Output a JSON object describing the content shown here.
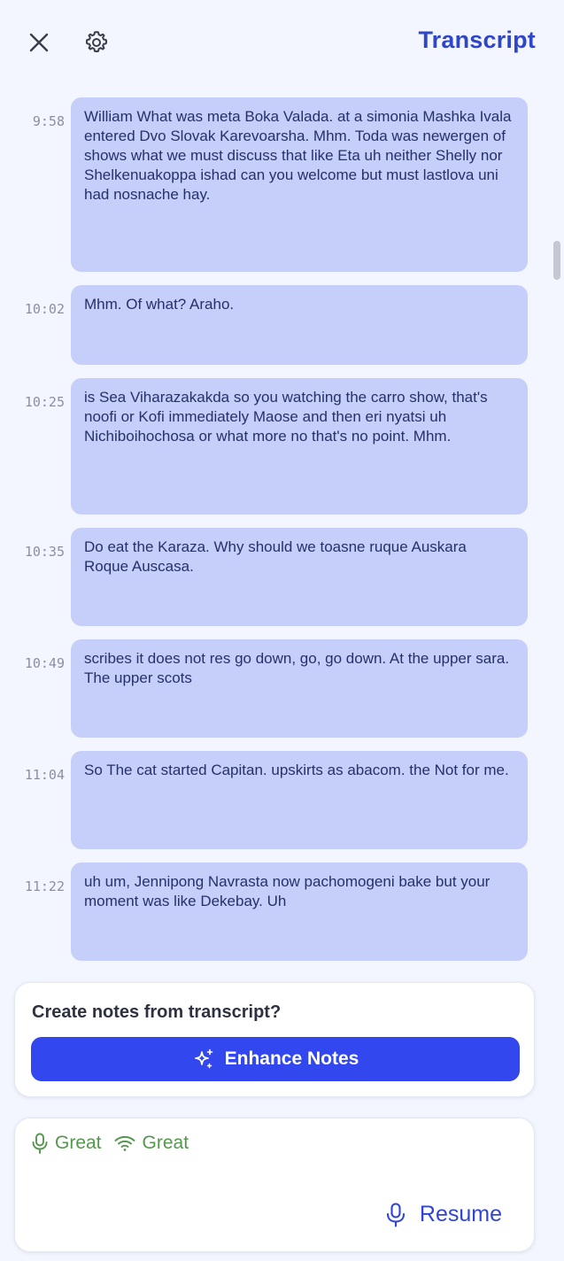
{
  "header": {
    "title": "Transcript",
    "close_icon": "close-icon",
    "settings_icon": "gear-icon"
  },
  "transcript": [
    {
      "time": "9:58",
      "text": "William What was meta Boka Valada. at a simonia Mashka Ivala entered Dvo Slovak Karevoarsha. Mhm. Toda was newergen of shows what we must discuss that like Eta uh neither Shelly nor Shelkenuakoppa ishad can you welcome but must lastlova uni had nosnache hay."
    },
    {
      "time": "10:02",
      "text": "Mhm. Of what? Araho."
    },
    {
      "time": "10:25",
      "text": "is Sea Viharazakakda so you watching the carro show, that's noofi or Kofi immediately Maose and then eri nyatsi uh Nichiboihochosa or what more no that's no point. Mhm."
    },
    {
      "time": "10:35",
      "text": "Do eat the Karaza. Why should we toasne ruque Auskara Roque Auscasa."
    },
    {
      "time": "10:49",
      "text": "scribes it does not res go down, go, go down. At the upper sara. The upper scots"
    },
    {
      "time": "11:04",
      "text": "So The cat started Capitan. upskirts as abacom. the Not for me."
    },
    {
      "time": "11:22",
      "text": "uh um, Jennipong Navrasta now pachomogeni bake but your moment was like Dekebay. Uh"
    }
  ],
  "enhance": {
    "prompt": "Create notes from transcript?",
    "button_label": "Enhance Notes",
    "button_icon": "sparkle-icon"
  },
  "status": {
    "mic_label": "Great",
    "mic_icon": "microphone-icon",
    "network_label": "Great",
    "network_icon": "wifi-icon",
    "resume_label": "Resume",
    "resume_icon": "microphone-icon"
  },
  "colors": {
    "accent": "#3247ed",
    "title": "#2f46c9",
    "bubble": "#c5cff9",
    "status_good": "#55974d",
    "background": "#f3f6fe"
  }
}
